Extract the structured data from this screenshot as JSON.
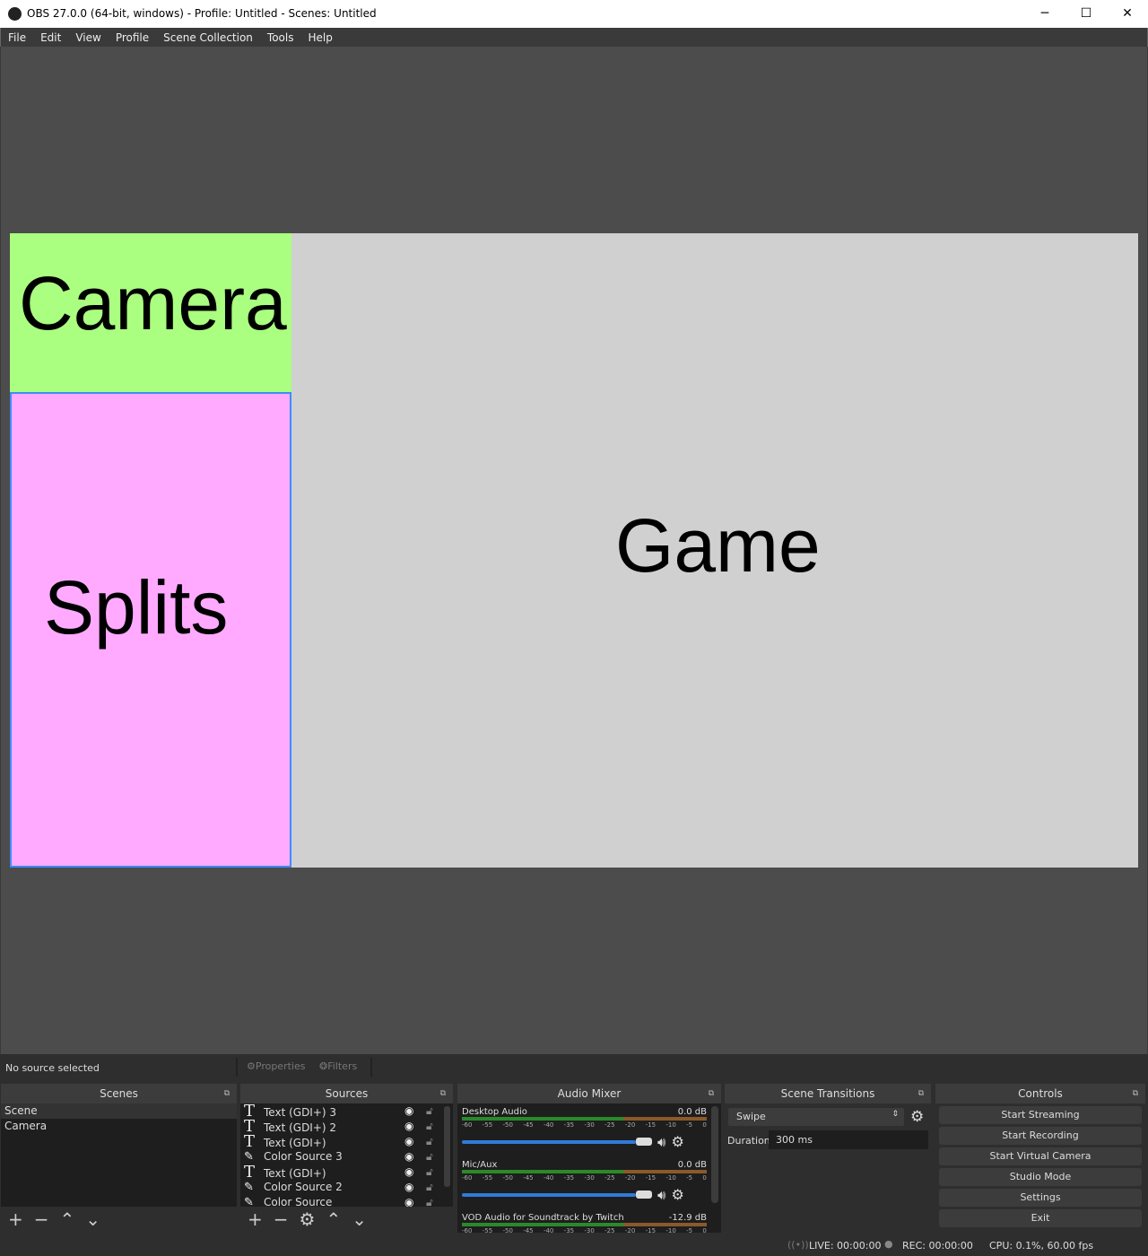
{
  "window": {
    "title": "OBS 27.0.0 (64-bit, windows) - Profile: Untitled - Scenes: Untitled",
    "minimize": "─",
    "maximize": "☐",
    "close": "✕"
  },
  "menu": [
    "File",
    "Edit",
    "View",
    "Profile",
    "Scene Collection",
    "Tools",
    "Help"
  ],
  "preview": {
    "camera": "Camera",
    "splits": "Splits",
    "game": "Game",
    "colors": {
      "camera": "#aaff80",
      "splits": "#ffaaff",
      "game": "#d0d0d0",
      "selection": "#3b8cff"
    }
  },
  "context_bar": {
    "status": "No source selected",
    "properties": "Properties",
    "filters": "Filters"
  },
  "scenes": {
    "title": "Scenes",
    "items": [
      "Scene",
      "Camera"
    ],
    "selected": "Scene"
  },
  "sources": {
    "title": "Sources",
    "items": [
      {
        "name": "Text (GDI+) 3",
        "icon": "text-icon"
      },
      {
        "name": "Text (GDI+) 2",
        "icon": "text-icon"
      },
      {
        "name": "Text (GDI+)",
        "icon": "text-icon"
      },
      {
        "name": "Color Source 3",
        "icon": "brush-icon"
      },
      {
        "name": "Text (GDI+)",
        "icon": "text-icon"
      },
      {
        "name": "Color Source 2",
        "icon": "brush-icon"
      },
      {
        "name": "Color Source",
        "icon": "brush-icon"
      }
    ]
  },
  "audio_mixer": {
    "title": "Audio Mixer",
    "ticks": [
      "-60",
      "-55",
      "-50",
      "-45",
      "-40",
      "-35",
      "-30",
      "-25",
      "-20",
      "-15",
      "-10",
      "-5",
      "0"
    ],
    "channels": [
      {
        "name": "Desktop Audio",
        "level": "0.0 dB",
        "volume_pct": 100
      },
      {
        "name": "Mic/Aux",
        "level": "0.0 dB",
        "volume_pct": 100
      },
      {
        "name": "VOD Audio for Soundtrack by Twitch",
        "level": "-12.9 dB",
        "volume_pct": 100
      }
    ]
  },
  "transitions": {
    "title": "Scene Transitions",
    "selected": "Swipe",
    "duration_label": "Duration",
    "duration": "300 ms"
  },
  "controls": {
    "title": "Controls",
    "buttons": [
      "Start Streaming",
      "Start Recording",
      "Start Virtual Camera",
      "Studio Mode",
      "Settings",
      "Exit"
    ]
  },
  "status": {
    "live": "LIVE: 00:00:00",
    "rec": "REC: 00:00:00",
    "cpu": "CPU: 0.1%, 60.00 fps"
  }
}
